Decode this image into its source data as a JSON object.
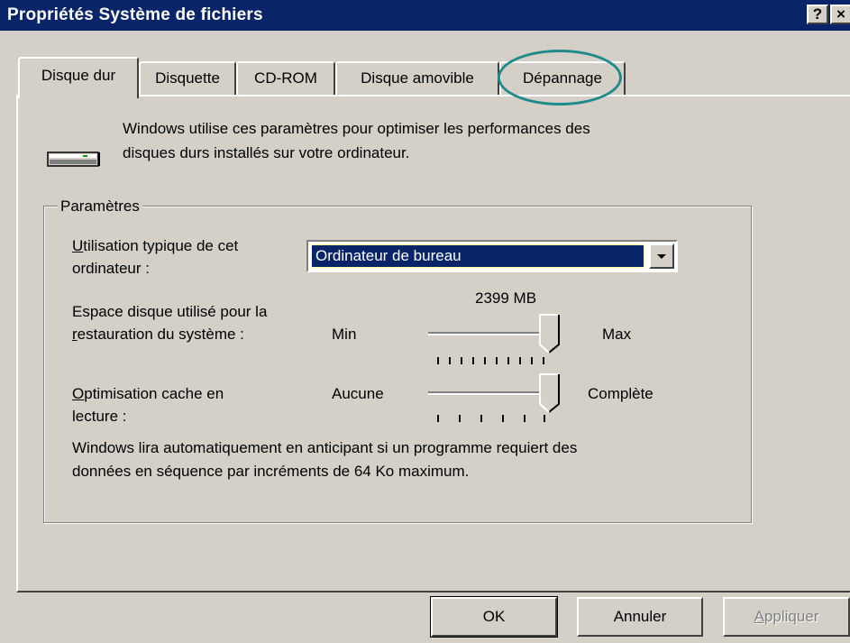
{
  "window": {
    "title": "Propriétés Système de fichiers",
    "help_glyph": "?",
    "close_glyph": "×"
  },
  "tabs": [
    {
      "label": "Disque dur",
      "active": true
    },
    {
      "label": "Disquette",
      "active": false
    },
    {
      "label": "CD-ROM",
      "active": false
    },
    {
      "label": "Disque amovible",
      "active": false
    },
    {
      "label": "Dépannage",
      "active": false,
      "highlighted": true
    }
  ],
  "intro": {
    "line1": "Windows utilise ces paramètres pour optimiser les performances des",
    "line2": "disques durs installés sur votre ordinateur.",
    "icon": "hard-drive-icon"
  },
  "group": {
    "label": "Paramètres",
    "usage_label_line1": "Utilisation typique de cet",
    "usage_label_line2": "ordinateur :",
    "usage_value": "Ordinateur de bureau",
    "restore_label_line1": "Espace disque utilisé pour la",
    "restore_label_line2": "restauration du système :",
    "restore_size": "2399 MB",
    "restore_min": "Min",
    "restore_max": "Max",
    "restore_level": 1.0,
    "cache_label_line1": "Optimisation cache en",
    "cache_label_line2": "lecture :",
    "cache_min": "Aucune",
    "cache_max": "Complète",
    "cache_level": 1.0,
    "note_line1": "Windows lira automatiquement en anticipant si un programme requiert des",
    "note_line2": "données en séquence par incréments de 64 Ko maximum."
  },
  "buttons": {
    "ok": "OK",
    "cancel": "Annuler",
    "apply": "Appliquer"
  },
  "colors": {
    "titlebar": "#0a246a",
    "face": "#d4d0c8",
    "selection": "#0a246a",
    "highlight_circle": "#1f8a8a"
  }
}
